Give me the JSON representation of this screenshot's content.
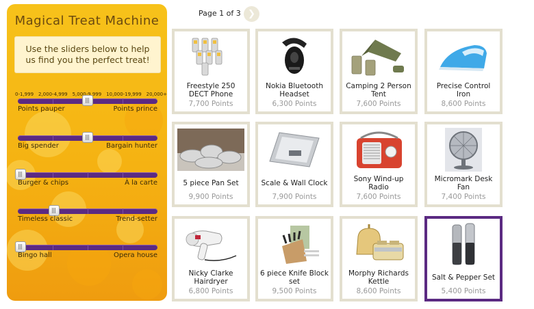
{
  "machine": {
    "title": "Magical Treat Machine",
    "intro": "Use the sliders below to help us find you the perfect treat!",
    "ranges": [
      "0-1,999",
      "2,000-4,999",
      "5,000-9,999",
      "10,000-19,999",
      "20,000+"
    ],
    "sliders": [
      {
        "left": "Points pauper",
        "right": "Points prince",
        "value": 0.5
      },
      {
        "left": "Big spender",
        "right": "Bargain hunter",
        "value": 0.5
      },
      {
        "left": "Burger & chips",
        "right": "À la carte",
        "value": 0.0
      },
      {
        "left": "Timeless classic",
        "right": "Trend-setter",
        "value": 0.25
      },
      {
        "left": "Bingo hall",
        "right": "Opera house",
        "value": 0.0
      }
    ]
  },
  "pager": {
    "label": "Page 1 of 3",
    "next_icon": "chevron-right-icon"
  },
  "products": [
    {
      "name": "Freestyle 250 DECT Phone",
      "points": "7,700 Points",
      "icon": "cordless-phones-icon"
    },
    {
      "name": "Nokia Bluetooth Headset",
      "points": "6,300 Points",
      "icon": "bluetooth-headset-icon"
    },
    {
      "name": "Camping 2 Person Tent",
      "points": "7,600 Points",
      "icon": "tent-icon"
    },
    {
      "name": "Precise Control Iron",
      "points": "8,600 Points",
      "icon": "iron-icon"
    },
    {
      "name": "5 piece Pan Set",
      "points": "9,900 Points",
      "icon": "pan-set-icon"
    },
    {
      "name": "Scale & Wall Clock",
      "points": "7,900 Points",
      "icon": "scale-icon"
    },
    {
      "name": "Sony Wind-up Radio",
      "points": "7,600 Points",
      "icon": "radio-icon"
    },
    {
      "name": "Micromark Desk Fan",
      "points": "7,400 Points",
      "icon": "desk-fan-icon"
    },
    {
      "name": "Nicky Clarke Hairdryer",
      "points": "6,800 Points",
      "icon": "hairdryer-icon"
    },
    {
      "name": "6 piece Knife Block set",
      "points": "9,500 Points",
      "icon": "knife-block-icon"
    },
    {
      "name": "Morphy Richards Kettle",
      "points": "8,600 Points",
      "icon": "kettle-toaster-icon"
    },
    {
      "name": "Salt & Pepper Set",
      "points": "5,400 Points",
      "icon": "salt-pepper-icon",
      "selected": true
    }
  ],
  "colors": {
    "accent": "#5b2a82",
    "panel": "#f5b212",
    "card_border": "#e3dfcf"
  }
}
